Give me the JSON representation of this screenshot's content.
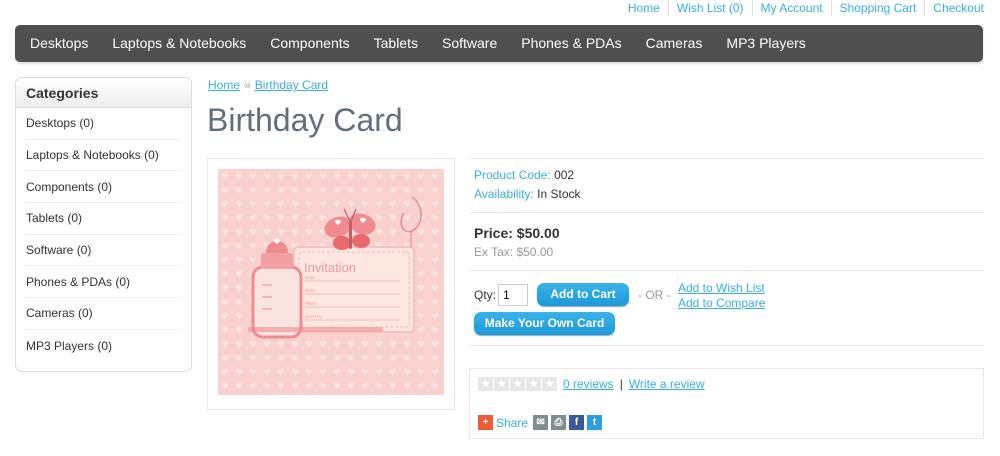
{
  "top_links": [
    "Home",
    "Wish List (0)",
    "My Account",
    "Shopping Cart",
    "Checkout"
  ],
  "menu": [
    "Desktops",
    "Laptops & Notebooks",
    "Components",
    "Tablets",
    "Software",
    "Phones & PDAs",
    "Cameras",
    "MP3 Players"
  ],
  "sidebar": {
    "title": "Categories",
    "items": [
      "Desktops (0)",
      "Laptops & Notebooks (0)",
      "Components (0)",
      "Tablets (0)",
      "Software (0)",
      "Phones & PDAs (0)",
      "Cameras (0)",
      "MP3 Players (0)"
    ]
  },
  "breadcrumb": {
    "home": "Home",
    "sep": "»",
    "current": "Birthday Card"
  },
  "product": {
    "title": "Birthday Card",
    "image_text": {
      "heading": "Invitation",
      "lines": [
        "Date:",
        "Date:",
        "Place:",
        "given by:"
      ]
    },
    "code_label": "Product Code:",
    "code": "002",
    "availability_label": "Availability:",
    "availability": "In Stock",
    "price": "Price: $50.00",
    "ex_tax": "Ex Tax: $50.00",
    "qty_label": "Qty:",
    "qty_value": "1",
    "add_to_cart": "Add to Cart",
    "or": "- OR -",
    "add_wishlist": "Add to Wish List",
    "add_compare": "Add to Compare",
    "make_card": "Make Your Own Card"
  },
  "review": {
    "reviews_link": "0 reviews",
    "separator": "|",
    "write_link": "Write a review",
    "share": "Share"
  },
  "colors": {
    "accent": "#38b0e3",
    "menu_bg": "#4f4f4f",
    "button": "#1d99d6",
    "card_bg": "#f9d2d0"
  }
}
